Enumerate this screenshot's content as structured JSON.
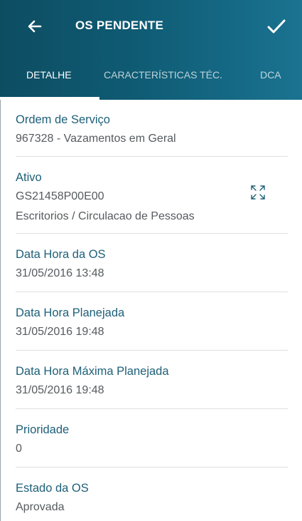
{
  "header": {
    "title": "OS PENDENTE",
    "back_icon": "arrow-left-icon",
    "confirm_icon": "check-icon"
  },
  "tabs": [
    {
      "label": "DETALHE",
      "active": true
    },
    {
      "label": "CARACTERÍSTICAS TÉC.",
      "active": false
    },
    {
      "label": "DCA",
      "active": false
    }
  ],
  "fields": {
    "ordem": {
      "label": "Ordem de Serviço",
      "value": "967328 - Vazamentos em Geral"
    },
    "ativo": {
      "label": "Ativo",
      "code": "GS21458P00E00",
      "location": "Escritorios / Circulacao de Pessoas",
      "action_icon": "expand-icon"
    },
    "data_os": {
      "label": "Data Hora da OS",
      "value": "31/05/2016 13:48"
    },
    "data_planejada": {
      "label": "Data Hora Planejada",
      "value": "31/05/2016 19:48"
    },
    "data_maxima": {
      "label": "Data Hora Máxima Planejada",
      "value": "31/05/2016 19:48"
    },
    "prioridade": {
      "label": "Prioridade",
      "value": "0"
    },
    "estado": {
      "label": "Estado da OS",
      "value": "Aprovada"
    }
  },
  "colors": {
    "appbar_start": "#0d4d62",
    "appbar_end": "#1a7391",
    "label": "#1d5f78",
    "value": "#555b5e"
  }
}
